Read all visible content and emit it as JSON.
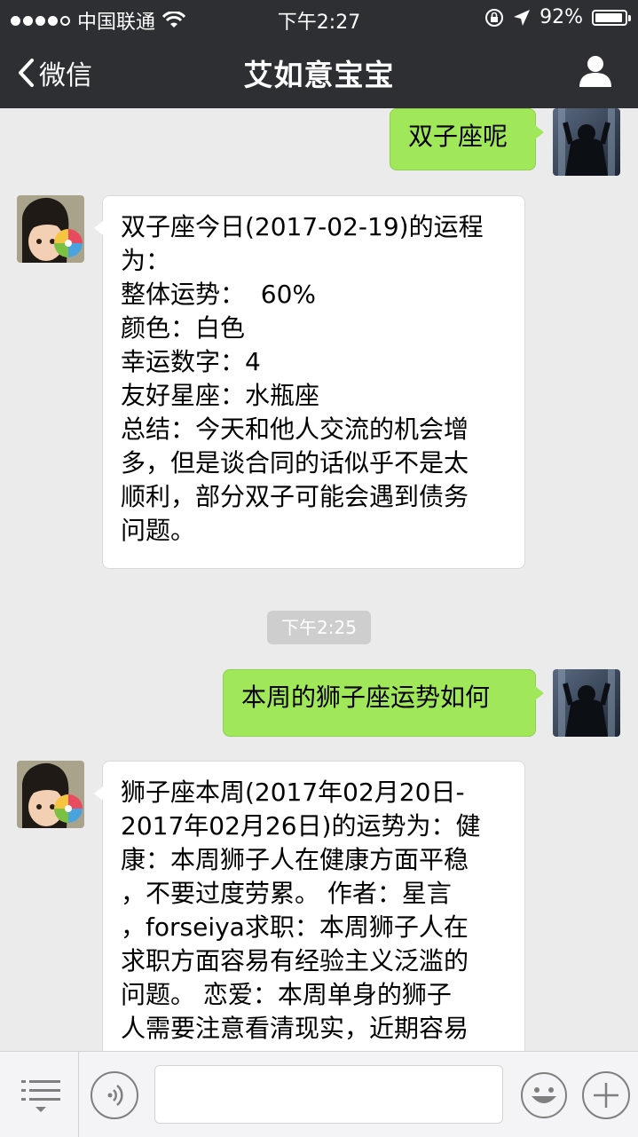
{
  "status_bar": {
    "carrier": "中国联通",
    "time": "下午2:27",
    "battery": "92%"
  },
  "nav": {
    "back_label": "微信",
    "title": "艾如意宝宝"
  },
  "chat": {
    "messages": [
      {
        "sender": "me",
        "text": "双子座呢"
      },
      {
        "sender": "them",
        "lines": [
          "双子座今日(2017-02-19)的运程",
          "为：",
          "整体运势：  60%",
          "颜色：白色",
          "幸运数字：4",
          "友好星座：水瓶座",
          "总结：今天和他人交流的机会增",
          "多，但是谈合同的话似乎不是太",
          "顺利，部分双子可能会遇到债务",
          "问题。"
        ]
      },
      {
        "sender": "me",
        "text": "本周的狮子座运势如何"
      },
      {
        "sender": "them",
        "lines": [
          "狮子座本周(2017年02月20日-",
          "2017年02月26日)的运势为：健",
          "康：本周狮子人在健康方面平稳",
          "，不要过度劳累。 作者：星言",
          "，forseiya求职：本周狮子人在",
          "求职方面容易有经验主义泛滥的",
          "问题。 恋爱：本周单身的狮子",
          "人需要注意看清现实，近期容易"
        ]
      }
    ],
    "timestamp": "下午2:25"
  },
  "icons": {
    "back": "chevron-left-icon",
    "profile": "person-icon",
    "menu": "menu-icon",
    "voice": "voice-icon",
    "emoji": "emoji-icon",
    "plus": "plus-icon"
  },
  "colors": {
    "bar": "#2e2f33",
    "background": "#ebebeb",
    "my_bubble": "#a0e75a",
    "their_bubble": "#ffffff"
  }
}
